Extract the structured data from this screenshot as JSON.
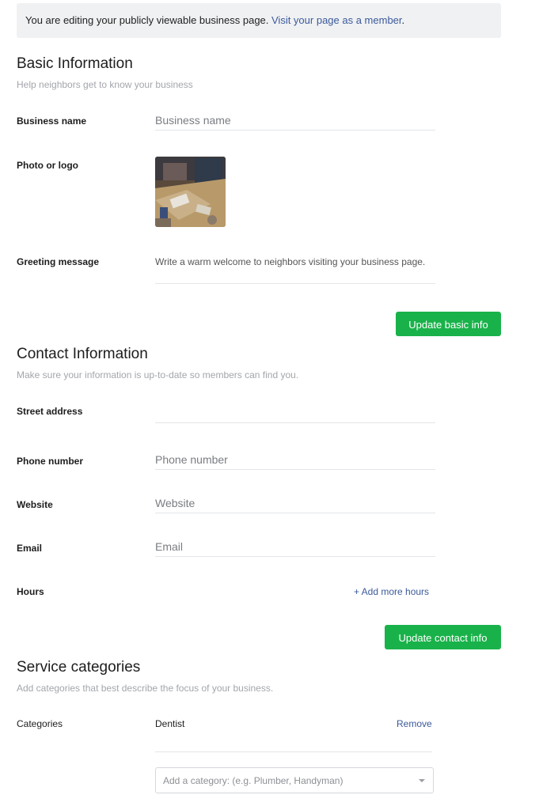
{
  "banner": {
    "text": "You are editing your publicly viewable business page. ",
    "link": "Visit your page as a member",
    "suffix": "."
  },
  "basic": {
    "title": "Basic Information",
    "subtitle": "Help neighbors get to know your business",
    "business_name_label": "Business name",
    "business_name_placeholder": "Business name",
    "photo_label": "Photo or logo",
    "greeting_label": "Greeting message",
    "greeting_placeholder": "Write a warm welcome to neighbors visiting your business page.",
    "update_button": "Update basic info"
  },
  "contact": {
    "title": "Contact Information",
    "subtitle": "Make sure your information is up-to-date so members can find you.",
    "street_label": "Street address",
    "phone_label": "Phone number",
    "phone_placeholder": "Phone number",
    "website_label": "Website",
    "website_placeholder": "Website",
    "email_label": "Email",
    "email_placeholder": "Email",
    "hours_label": "Hours",
    "add_hours_link": "+ Add more hours",
    "update_button": "Update contact info"
  },
  "services": {
    "title": "Service categories",
    "subtitle": "Add categories that best describe the focus of your business.",
    "categories_label": "Categories",
    "categories": [
      {
        "name": "Dentist",
        "remove_label": "Remove"
      }
    ],
    "add_placeholder": "Add a category: (e.g. Plumber, Handyman)"
  },
  "colors": {
    "accent_green": "#19b24a",
    "link_blue": "#3b5a9a"
  }
}
